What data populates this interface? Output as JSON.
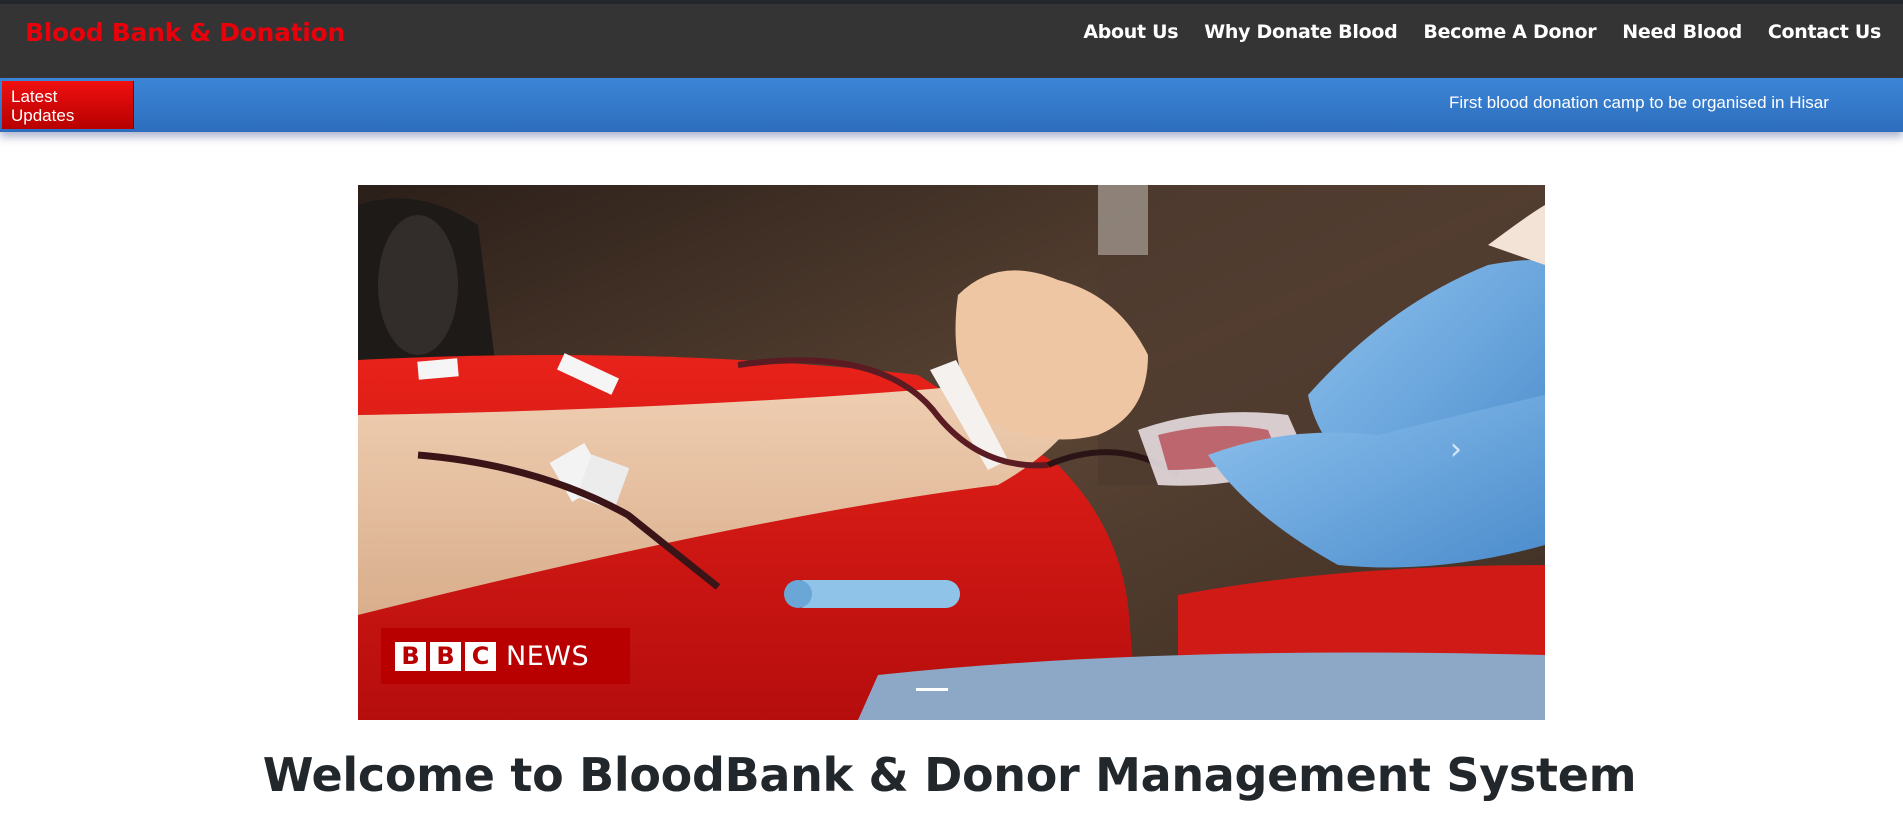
{
  "brand": "Blood Bank & Donation",
  "nav": {
    "items": [
      {
        "label": "About Us"
      },
      {
        "label": "Why Donate Blood"
      },
      {
        "label": "Become A Donor"
      },
      {
        "label": "Need Blood"
      },
      {
        "label": "Contact Us"
      }
    ]
  },
  "updates": {
    "label": "Latest Updates",
    "text": "First blood donation camp to be organised in Hisar"
  },
  "carousel": {
    "logo_letters": [
      "B",
      "B",
      "C"
    ],
    "logo_news": "NEWS",
    "next_icon": "chevron-right-icon",
    "active_slide": 1
  },
  "welcome": "Welcome to BloodBank & Donor Management System",
  "colors": {
    "brand": "#e8000b",
    "navbar_bg": "#343434",
    "updates_bar": "#3a80d2",
    "updates_label": "#e40000",
    "bbc_red": "#b80000"
  }
}
